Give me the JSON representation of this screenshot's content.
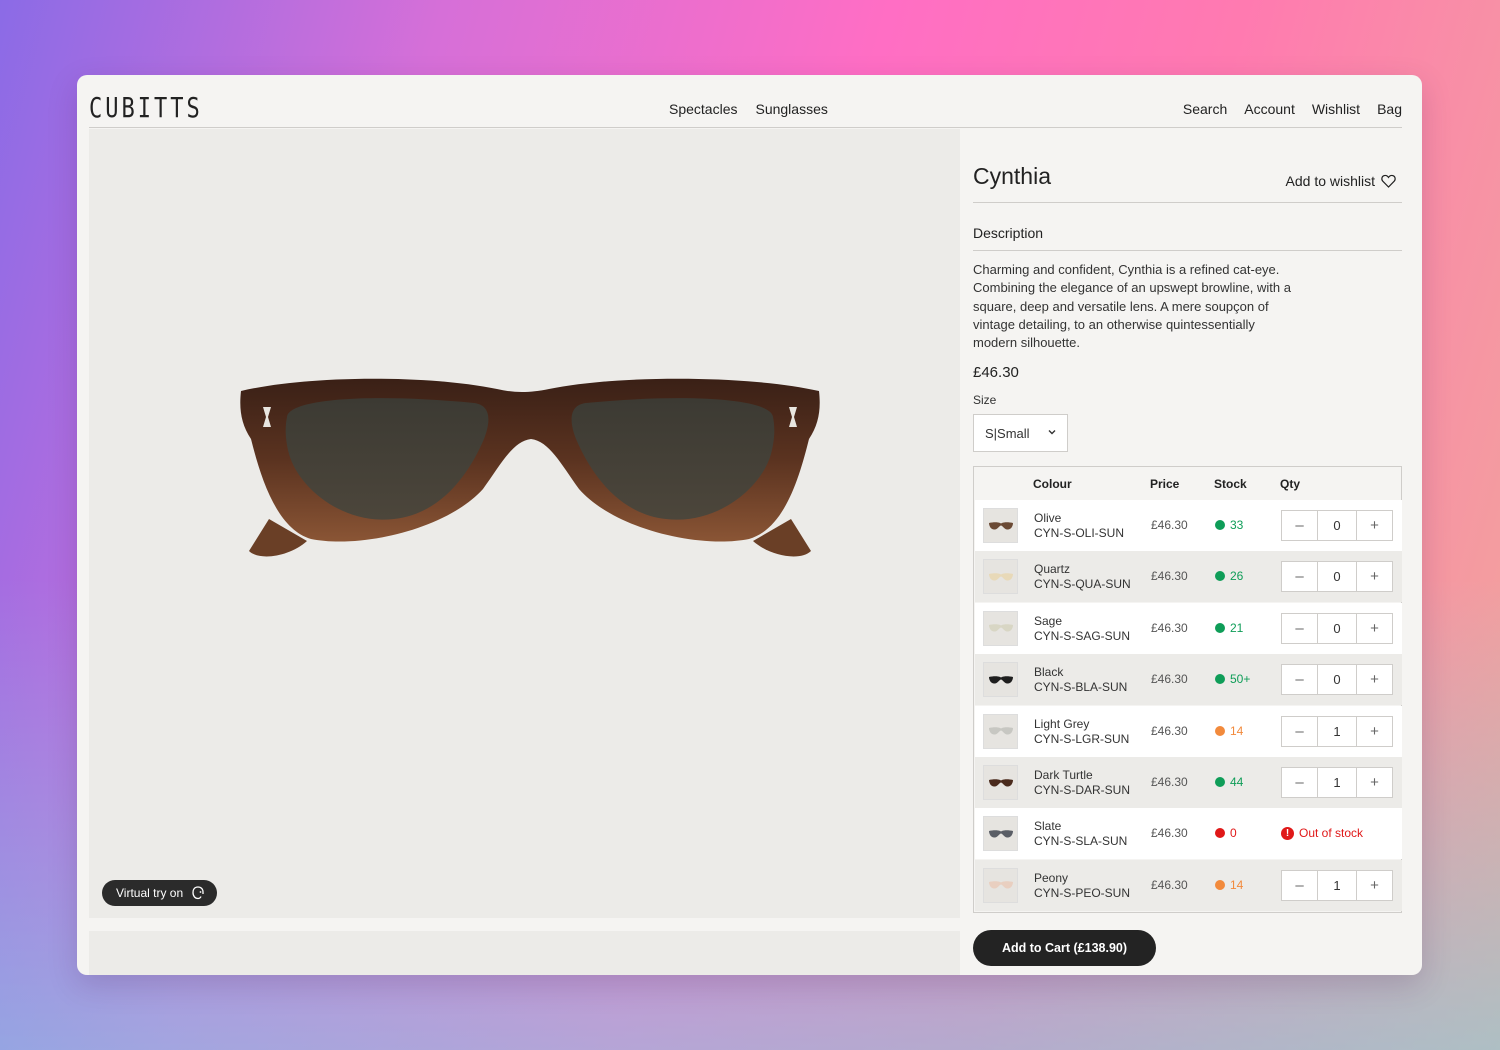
{
  "brand": {
    "logo": "CUBITTS"
  },
  "nav": {
    "center": [
      "Spectacles",
      "Sunglasses"
    ],
    "right": [
      "Search",
      "Account",
      "Wishlist",
      "Bag"
    ]
  },
  "gallery": {
    "virtual_try_on": "Virtual try on"
  },
  "product": {
    "title": "Cynthia",
    "add_to_wishlist": "Add to wishlist",
    "description_heading": "Description",
    "description": "Charming and confident, Cynthia is a refined cat-eye. Combining the elegance of an upswept browline, with a square, deep and versatile lens. A mere soupçon of vintage detailing, to an otherwise quintessentially modern silhouette.",
    "price": "£46.30",
    "size_label": "Size",
    "size_selected": "S|Small"
  },
  "table": {
    "headers": {
      "colour": "Colour",
      "price": "Price",
      "stock": "Stock",
      "qty": "Qty"
    },
    "rows": [
      {
        "colour": "Olive",
        "sku": "CYN-S-OLI-SUN",
        "price": "£46.30",
        "stock": "33",
        "stock_status": "in",
        "qty": "0",
        "thumb_color": "#6b4a35"
      },
      {
        "colour": "Quartz",
        "sku": "CYN-S-QUA-SUN",
        "price": "£46.30",
        "stock": "26",
        "stock_status": "in",
        "qty": "0",
        "thumb_color": "#e8d9b8"
      },
      {
        "colour": "Sage",
        "sku": "CYN-S-SAG-SUN",
        "price": "£46.30",
        "stock": "21",
        "stock_status": "in",
        "qty": "0",
        "thumb_color": "#d8d6c4"
      },
      {
        "colour": "Black",
        "sku": "CYN-S-BLA-SUN",
        "price": "£46.30",
        "stock": "50+",
        "stock_status": "in",
        "qty": "0",
        "thumb_color": "#1e1e1e"
      },
      {
        "colour": "Light Grey",
        "sku": "CYN-S-LGR-SUN",
        "price": "£46.30",
        "stock": "14",
        "stock_status": "low",
        "qty": "1",
        "thumb_color": "#c7c7c2"
      },
      {
        "colour": "Dark Turtle",
        "sku": "CYN-S-DAR-SUN",
        "price": "£46.30",
        "stock": "44",
        "stock_status": "in",
        "qty": "1",
        "thumb_color": "#4a2a1c"
      },
      {
        "colour": "Slate",
        "sku": "CYN-S-SLA-SUN",
        "price": "£46.30",
        "stock": "0",
        "stock_status": "out",
        "qty": null,
        "out_of_stock_label": "Out of stock",
        "thumb_color": "#5a5e66"
      },
      {
        "colour": "Peony",
        "sku": "CYN-S-PEO-SUN",
        "price": "£46.30",
        "stock": "14",
        "stock_status": "low",
        "qty": "1",
        "thumb_color": "#e9cfc0"
      }
    ]
  },
  "cart": {
    "label": "Add to Cart (£138.90)"
  },
  "colors": {
    "in_stock": "#0f9d58",
    "low_stock": "#f28a3c",
    "out_of_stock": "#e01818",
    "button_dark": "#232323"
  },
  "icons": [
    "heart-icon",
    "chevron-down-icon",
    "minus-icon",
    "plus-icon",
    "face-scan-icon",
    "alert-icon"
  ]
}
